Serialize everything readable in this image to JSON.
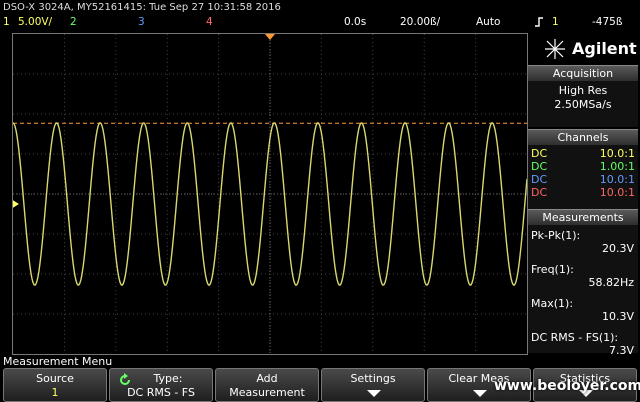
{
  "header": {
    "title": "DSO-X 3024A, MY52161415: Tue Sep 27 10:31:58 2016",
    "ch1_num": "1",
    "ch1_scale": "5.00V/",
    "ch2_num": "2",
    "ch3_num": "3",
    "ch4_num": "4",
    "time_pos": "0.0s",
    "time_scale": "20.00ß/",
    "trigger_mode": "Auto",
    "trigger_icon": "rising-edge-icon",
    "trigger_src": "1",
    "trigger_level": "-475ß"
  },
  "colors": {
    "ch1": "#ffff66",
    "ch2": "#66ff66",
    "ch3": "#6699ff",
    "ch4": "#ff6666",
    "trace": "#d8d870",
    "trigger_line": "#ff9933"
  },
  "brand": {
    "name": "Agilent"
  },
  "acquisition": {
    "heading": "Acquisition",
    "mode": "High Res",
    "rate": "2.50MSa/s"
  },
  "channels": {
    "heading": "Channels",
    "rows": [
      {
        "coupling": "DC",
        "probe": "10.0:1"
      },
      {
        "coupling": "DC",
        "probe": "1.00:1"
      },
      {
        "coupling": "DC",
        "probe": "10.0:1"
      },
      {
        "coupling": "DC",
        "probe": "10.0:1"
      }
    ]
  },
  "measurements": {
    "heading": "Measurements",
    "items": [
      {
        "label": "Pk-Pk(1):",
        "value": "20.3V"
      },
      {
        "label": "Freq(1):",
        "value": "58.82Hz"
      },
      {
        "label": "Max(1):",
        "value": "10.3V"
      },
      {
        "label": "DC RMS - FS(1):",
        "value": "7.3V"
      }
    ]
  },
  "menu": {
    "title": "Measurement Menu",
    "softkeys": [
      {
        "line1": "Source",
        "line2": "1"
      },
      {
        "line1": "Type:",
        "line2": "DC RMS - FS"
      },
      {
        "line1": "Add",
        "line2": "Measurement"
      },
      {
        "line1": "Settings",
        "line2": ""
      },
      {
        "line1": "Clear Meas",
        "line2": ""
      },
      {
        "line1": "Statistics",
        "line2": ""
      }
    ]
  },
  "watermark": "www.beoloyer.com",
  "waveform": {
    "cycles": 11.8,
    "amplitude_v": 10.15,
    "volts_per_div": 5.0,
    "phase_deg": 90
  }
}
